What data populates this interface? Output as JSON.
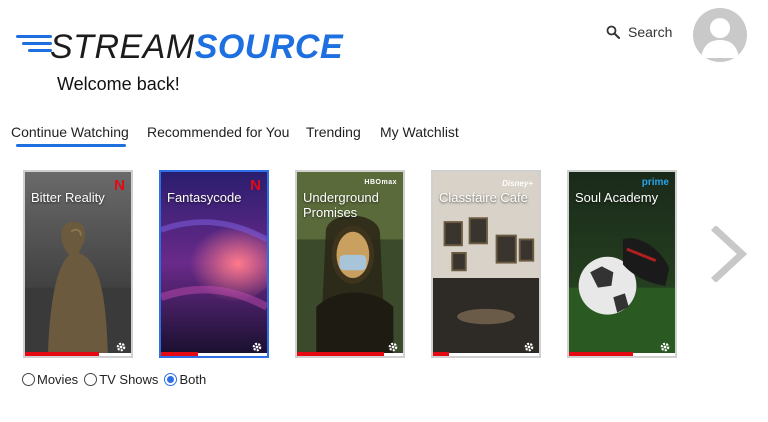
{
  "brand": {
    "part1": "STREAM",
    "part2": "SOURCE"
  },
  "welcome": "Welcome back!",
  "search": {
    "label": "Search",
    "icon": "search-icon"
  },
  "avatar": {
    "icon": "user-avatar-icon"
  },
  "tabs": [
    {
      "label": "Continue Watching",
      "active": true
    },
    {
      "label": "Recommended for You",
      "active": false
    },
    {
      "label": "Trending",
      "active": false
    },
    {
      "label": "My Watchlist",
      "active": false
    }
  ],
  "cards": [
    {
      "title": "Bitter Reality",
      "brand": "N",
      "brand_type": "netflix",
      "progress": 0.7,
      "selected": false
    },
    {
      "title": "Fantasycode",
      "brand": "N",
      "brand_type": "netflix",
      "progress": 0.35,
      "selected": true
    },
    {
      "title": "Underground Promises",
      "brand": "HBOmax",
      "brand_type": "hbo",
      "progress": 0.82,
      "selected": false
    },
    {
      "title": "Classfaire Cafe",
      "brand": "Disney+",
      "brand_type": "disney",
      "progress": 0.15,
      "selected": false
    },
    {
      "title": "Soul Academy",
      "brand": "prime",
      "brand_type": "prime",
      "progress": 0.6,
      "selected": false
    }
  ],
  "filters": [
    {
      "label": "Movies",
      "checked": false
    },
    {
      "label": "TV Shows",
      "checked": false
    },
    {
      "label": "Both",
      "checked": true
    }
  ],
  "colors": {
    "accent": "#1e6fe0",
    "progress": "#e50914"
  }
}
